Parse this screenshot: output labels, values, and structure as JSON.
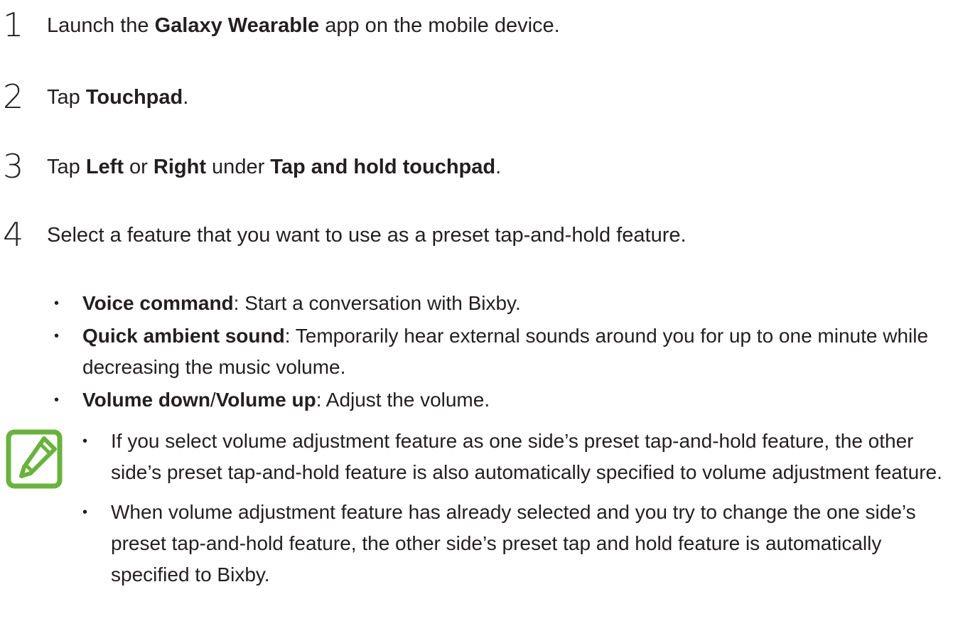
{
  "steps": [
    {
      "number": "1",
      "parts": [
        "Launch the ",
        "Galaxy Wearable",
        " app on the mobile device."
      ]
    },
    {
      "number": "2",
      "parts": [
        "Tap ",
        "Touchpad",
        "."
      ]
    },
    {
      "number": "3",
      "parts": [
        "Tap ",
        "Left",
        " or ",
        "Right",
        " under ",
        "Tap and hold touchpad",
        "."
      ]
    },
    {
      "number": "4",
      "text": "Select a feature that you want to use as a preset tap-and-hold feature."
    }
  ],
  "features": [
    {
      "name": "Voice command",
      "desc": ": Start a conversation with Bixby."
    },
    {
      "name": "Quick ambient sound",
      "desc": ": Temporarily hear external sounds around you for up to one minute while decreasing the music volume."
    },
    {
      "name_a": "Volume down",
      "sep": "/",
      "name_b": "Volume up",
      "desc": ": Adjust the volume."
    }
  ],
  "bullet_char": "•",
  "note": {
    "icon": "note-pencil-icon",
    "icon_color": "#6ab23d",
    "items": [
      "If you select volume adjustment feature as one side’s preset tap-and-hold feature, the other side’s preset tap-and-hold feature is also automatically specified to volume adjustment feature.",
      "When volume adjustment feature has already selected and you try to change the one side’s preset tap-and-hold feature, the other side’s preset tap and hold feature is automatically specified to Bixby."
    ]
  }
}
